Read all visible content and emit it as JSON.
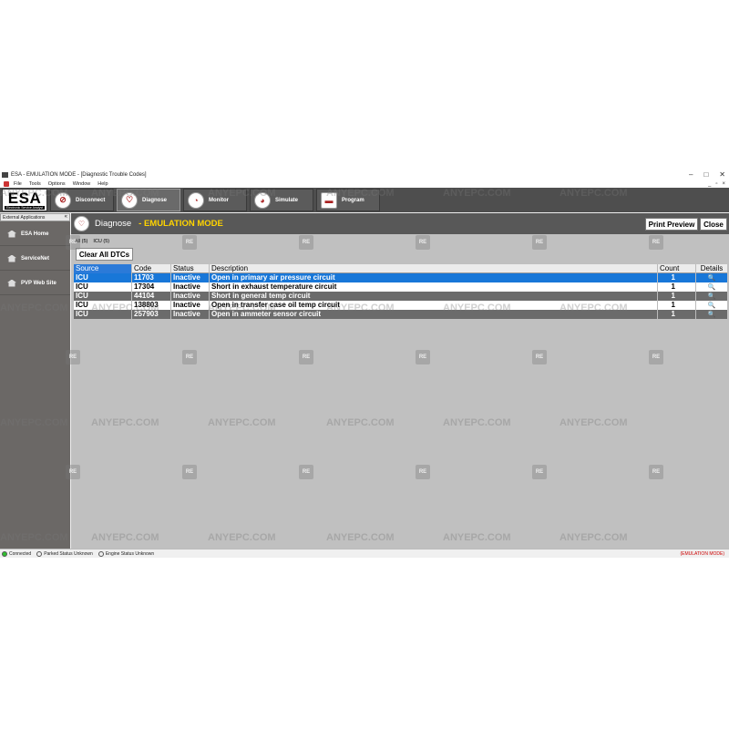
{
  "window": {
    "title": "ESA - EMULATION MODE - [Diagnostic Trouble Codes]",
    "minimize": "–",
    "maximize": "□",
    "close": "✕"
  },
  "menu": {
    "items": [
      "File",
      "Tools",
      "Options",
      "Window",
      "Help"
    ],
    "mdi": {
      "minimize": "_",
      "restore": "▫",
      "close": "×"
    }
  },
  "toolbar": {
    "logo_text": "ESA",
    "logo_sub": "Electronic Service Analyst",
    "buttons": [
      {
        "label": "Disconnect",
        "icon": "disconnect-icon",
        "glyph": "⊘"
      },
      {
        "label": "Diagnose",
        "icon": "stethoscope-icon",
        "glyph": "♡"
      },
      {
        "label": "Monitor",
        "icon": "gauge-icon",
        "glyph": "◔"
      },
      {
        "label": "Simulate",
        "icon": "gauge-icon",
        "glyph": "◕"
      },
      {
        "label": "Program",
        "icon": "chip-icon",
        "glyph": "▬"
      }
    ]
  },
  "sidebar": {
    "header": "External Applications",
    "header_chevron": "«",
    "items": [
      {
        "label": "ESA Home"
      },
      {
        "label": "ServiceNet"
      },
      {
        "label": "PVP Web Site"
      }
    ]
  },
  "diagnose": {
    "title": "Diagnose",
    "mode": "- EMULATION MODE",
    "icon_glyph": "♡",
    "print_preview": "Print Preview",
    "close": "Close",
    "filters": [
      "All (5)",
      "ICU (5)"
    ],
    "clear_all": "Clear All DTCs"
  },
  "table": {
    "headers": [
      "Source",
      "Code",
      "Status",
      "Description",
      "Count",
      "Details"
    ],
    "rows": [
      {
        "source": "ICU",
        "code": "11703",
        "status": "Inactive",
        "description": "Open in primary air pressure circuit",
        "count": "1",
        "details": "🔍"
      },
      {
        "source": "ICU",
        "code": "17304",
        "status": "Inactive",
        "description": "Short in exhaust temperature circuit",
        "count": "1",
        "details": "🔍"
      },
      {
        "source": "ICU",
        "code": "44104",
        "status": "Inactive",
        "description": "Short in general temp circuit",
        "count": "1",
        "details": "🔍"
      },
      {
        "source": "ICU",
        "code": "138803",
        "status": "Inactive",
        "description": "Open in transfer case oil temp circuit",
        "count": "1",
        "details": "🔍"
      },
      {
        "source": "ICU",
        "code": "257903",
        "status": "Inactive",
        "description": "Open in ammeter sensor circuit",
        "count": "1",
        "details": "🔍"
      }
    ]
  },
  "statusbar": {
    "connected": "Connected",
    "parked": "Parked Status Unknown",
    "engine": "Engine Status Unknown",
    "mode": "(EMULATION MODE)"
  },
  "watermark": {
    "text": "ANYEPC.COM",
    "logo": "RE"
  },
  "colors": {
    "selected_row": "#1877d8",
    "emulation_yellow": "#ffd400",
    "toolbar_bg": "#4e4e4e",
    "sidebar_bg": "#6b6866",
    "status_green": "#2fbf2f"
  }
}
